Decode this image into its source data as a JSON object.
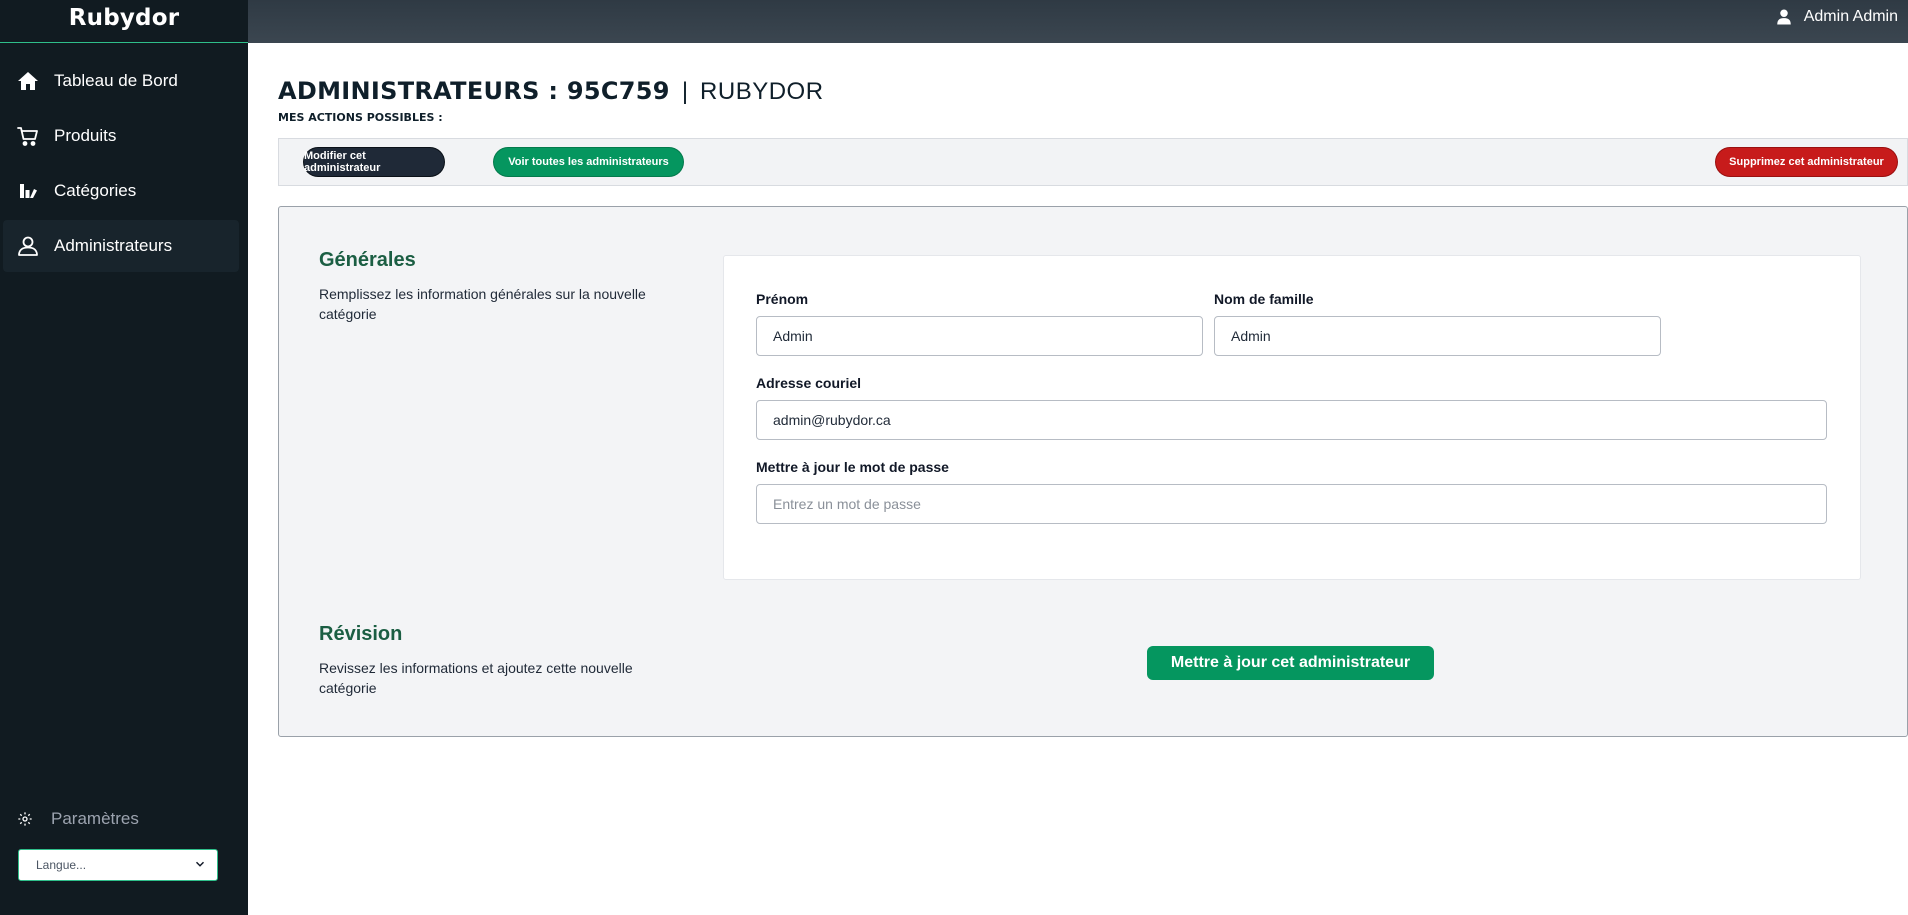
{
  "app": {
    "brand": "Rubydor"
  },
  "sidebar": {
    "items": [
      {
        "label": "Tableau de Bord",
        "icon": "home-icon"
      },
      {
        "label": "Produits",
        "icon": "cart-icon"
      },
      {
        "label": "Catégories",
        "icon": "categories-icon"
      },
      {
        "label": "Administrateurs",
        "icon": "user-icon",
        "active": true
      }
    ],
    "settings_label": "Paramètres",
    "language_select": {
      "selected": "Langue..."
    }
  },
  "topbar": {
    "user_name": "Admin Admin"
  },
  "page": {
    "title_main": "ADMINISTRATEURS : 95C759",
    "title_separator": "|",
    "title_sub": "RUBYDOR",
    "actions_label": "MES ACTIONS POSSIBLES :"
  },
  "actions": {
    "edit_label": "Modifier cet administrateur",
    "view_all_label": "Voir toutes les administrateurs",
    "delete_label": "Supprimez cet administrateur"
  },
  "form": {
    "general_title": "Générales",
    "general_desc": "Remplissez les information générales sur la nouvelle catégorie",
    "first_name_label": "Prénom",
    "first_name_value": "Admin",
    "last_name_label": "Nom de famille",
    "last_name_value": "Admin",
    "email_label": "Adresse couriel",
    "email_value": "admin@rubydor.ca",
    "password_label": "Mettre à jour le mot de passe",
    "password_placeholder": "Entrez un mot de passe",
    "review_title": "Révision",
    "review_desc": "Revissez les informations et ajoutez cette nouvelle catégorie",
    "submit_label": "Mettre à jour cet administrateur"
  },
  "colors": {
    "sidebar_bg": "#111b21",
    "accent_green": "#05965f",
    "danger_red": "#c71b1b",
    "section_title_green": "#1b5e43"
  }
}
